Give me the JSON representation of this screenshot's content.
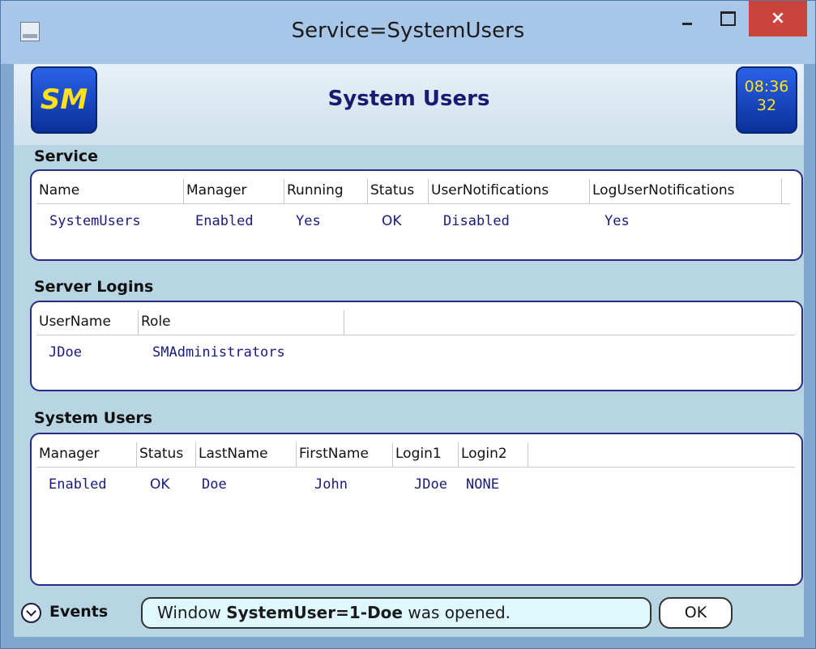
{
  "window": {
    "title": "Service=SystemUsers",
    "close_glyph": "×"
  },
  "header": {
    "logo_text": "SM",
    "title": "System Users",
    "clock_time": "08:36",
    "clock_seconds": "32"
  },
  "service": {
    "label": "Service",
    "columns": [
      "Name",
      "Manager",
      "Running",
      "Status",
      "UserNotifications",
      "LogUserNotifications"
    ],
    "rows": [
      [
        "SystemUsers",
        "Enabled",
        "Yes",
        "OK",
        "Disabled",
        "Yes"
      ]
    ]
  },
  "server_logins": {
    "label": "Server Logins",
    "columns": [
      "UserName",
      "Role"
    ],
    "rows": [
      [
        "JDoe",
        "SMAdministrators"
      ]
    ]
  },
  "system_users": {
    "label": "System Users",
    "columns": [
      "Manager",
      "Status",
      "LastName",
      "FirstName",
      "Login1",
      "Login2"
    ],
    "rows": [
      [
        "Enabled",
        "OK",
        "Doe",
        "John",
        "JDoe",
        "NONE"
      ]
    ]
  },
  "events": {
    "label": "Events",
    "message_prefix": "Window ",
    "message_bold": "SystemUser=1-Doe",
    "message_suffix": " was opened.",
    "ok_label": "OK"
  },
  "colors": {
    "accent": "#2a63e8",
    "clock_text": "#ffe21a",
    "value_text": "#1a1a7a",
    "close_button": "#c9443a"
  }
}
